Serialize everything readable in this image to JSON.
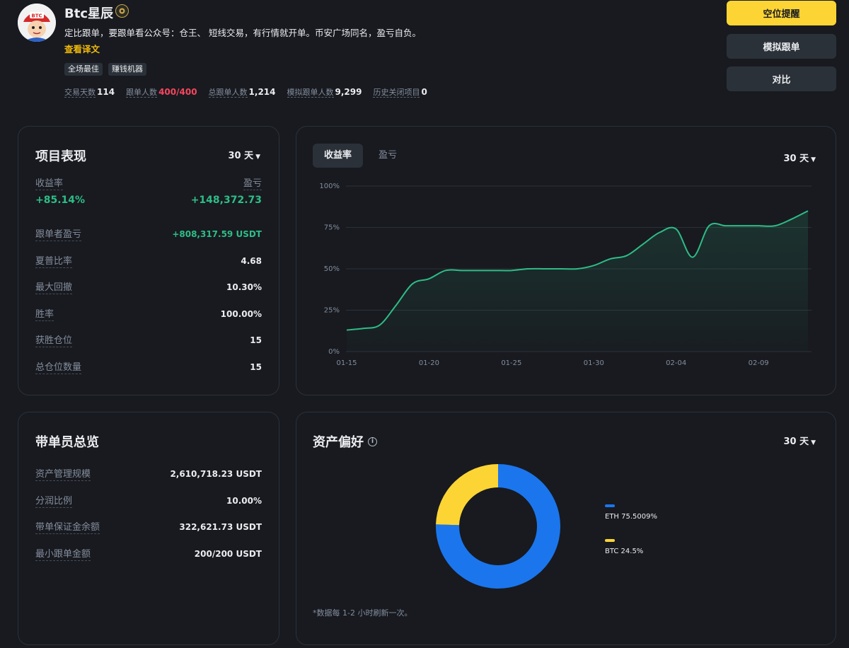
{
  "profile": {
    "name": "Btc星辰",
    "avatar_text": "BTC",
    "bio": "定比跟单，要跟单看公众号：仓王、 短线交易，有行情就开单。币安广场同名，盈亏自负。",
    "translate_link": "查看译文",
    "tags": [
      "全场最佳",
      "赚钱机器"
    ],
    "stats": [
      {
        "label": "交易天数",
        "value": "114",
        "highlight": false
      },
      {
        "label": "跟单人数",
        "value": "400/400",
        "highlight": true
      },
      {
        "label": "总跟单人数",
        "value": "1,214",
        "highlight": false
      },
      {
        "label": "模拟跟单人数",
        "value": "9,299",
        "highlight": false
      },
      {
        "label": "历史关闭项目",
        "value": "0",
        "highlight": false
      }
    ]
  },
  "actions": {
    "alert": "空位提醒",
    "mock": "模拟跟单",
    "compare": "对比"
  },
  "performance": {
    "title": "项目表现",
    "period": "30 天",
    "roi_label": "收益率",
    "pnl_label": "盈亏",
    "roi_value": "+85.14%",
    "pnl_value": "+148,372.73",
    "rows": [
      {
        "label": "跟单者盈亏",
        "value": "+808,317.59 USDT",
        "green": true
      },
      {
        "label": "夏普比率",
        "value": "4.68",
        "green": false
      },
      {
        "label": "最大回撤",
        "value": "10.30%",
        "green": false
      },
      {
        "label": "胜率",
        "value": "100.00%",
        "green": false
      },
      {
        "label": "获胜仓位",
        "value": "15",
        "green": false
      },
      {
        "label": "总仓位数量",
        "value": "15",
        "green": false
      }
    ]
  },
  "chart_panel": {
    "tabs": [
      "收益率",
      "盈亏"
    ],
    "period": "30 天"
  },
  "chart_data": {
    "type": "area",
    "x": [
      "01-15",
      "01-16",
      "01-17",
      "01-18",
      "01-19",
      "01-20",
      "01-21",
      "01-22",
      "01-23",
      "01-24",
      "01-25",
      "01-26",
      "01-27",
      "01-28",
      "01-29",
      "01-30",
      "01-31",
      "02-01",
      "02-02",
      "02-03",
      "02-04",
      "02-05",
      "02-06",
      "02-07",
      "02-08",
      "02-09",
      "02-10",
      "02-11",
      "02-12"
    ],
    "xticks": [
      "01-15",
      "01-20",
      "01-25",
      "01-30",
      "02-04",
      "02-09"
    ],
    "series": [
      {
        "values": [
          13,
          14,
          16,
          28,
          41,
          44,
          49,
          49,
          49,
          49,
          49,
          50,
          50,
          50,
          50,
          52,
          56,
          58,
          65,
          72,
          74,
          57,
          76,
          76,
          76,
          76,
          76,
          80,
          85
        ]
      }
    ],
    "yticks": [
      "0%",
      "25%",
      "50%",
      "75%",
      "100%"
    ],
    "ylim": [
      0,
      100
    ],
    "color": "#2ebd85",
    "grid": true
  },
  "overview": {
    "title": "带单员总览",
    "rows": [
      {
        "label": "资产管理规模",
        "value": "2,610,718.23 USDT"
      },
      {
        "label": "分润比例",
        "value": "10.00%"
      },
      {
        "label": "带单保证金余额",
        "value": "322,621.73 USDT"
      },
      {
        "label": "最小跟单金额",
        "value": "200/200 USDT"
      }
    ]
  },
  "assets": {
    "title": "资产偏好",
    "period": "30 天",
    "footnote": "*数据每 1-2 小时刷新一次。",
    "slices": [
      {
        "label": "ETH 75.5009%",
        "value": 75.5009,
        "color": "#1b76ed"
      },
      {
        "label": "BTC 24.5%",
        "value": 24.5,
        "color": "#fcd535"
      }
    ]
  }
}
